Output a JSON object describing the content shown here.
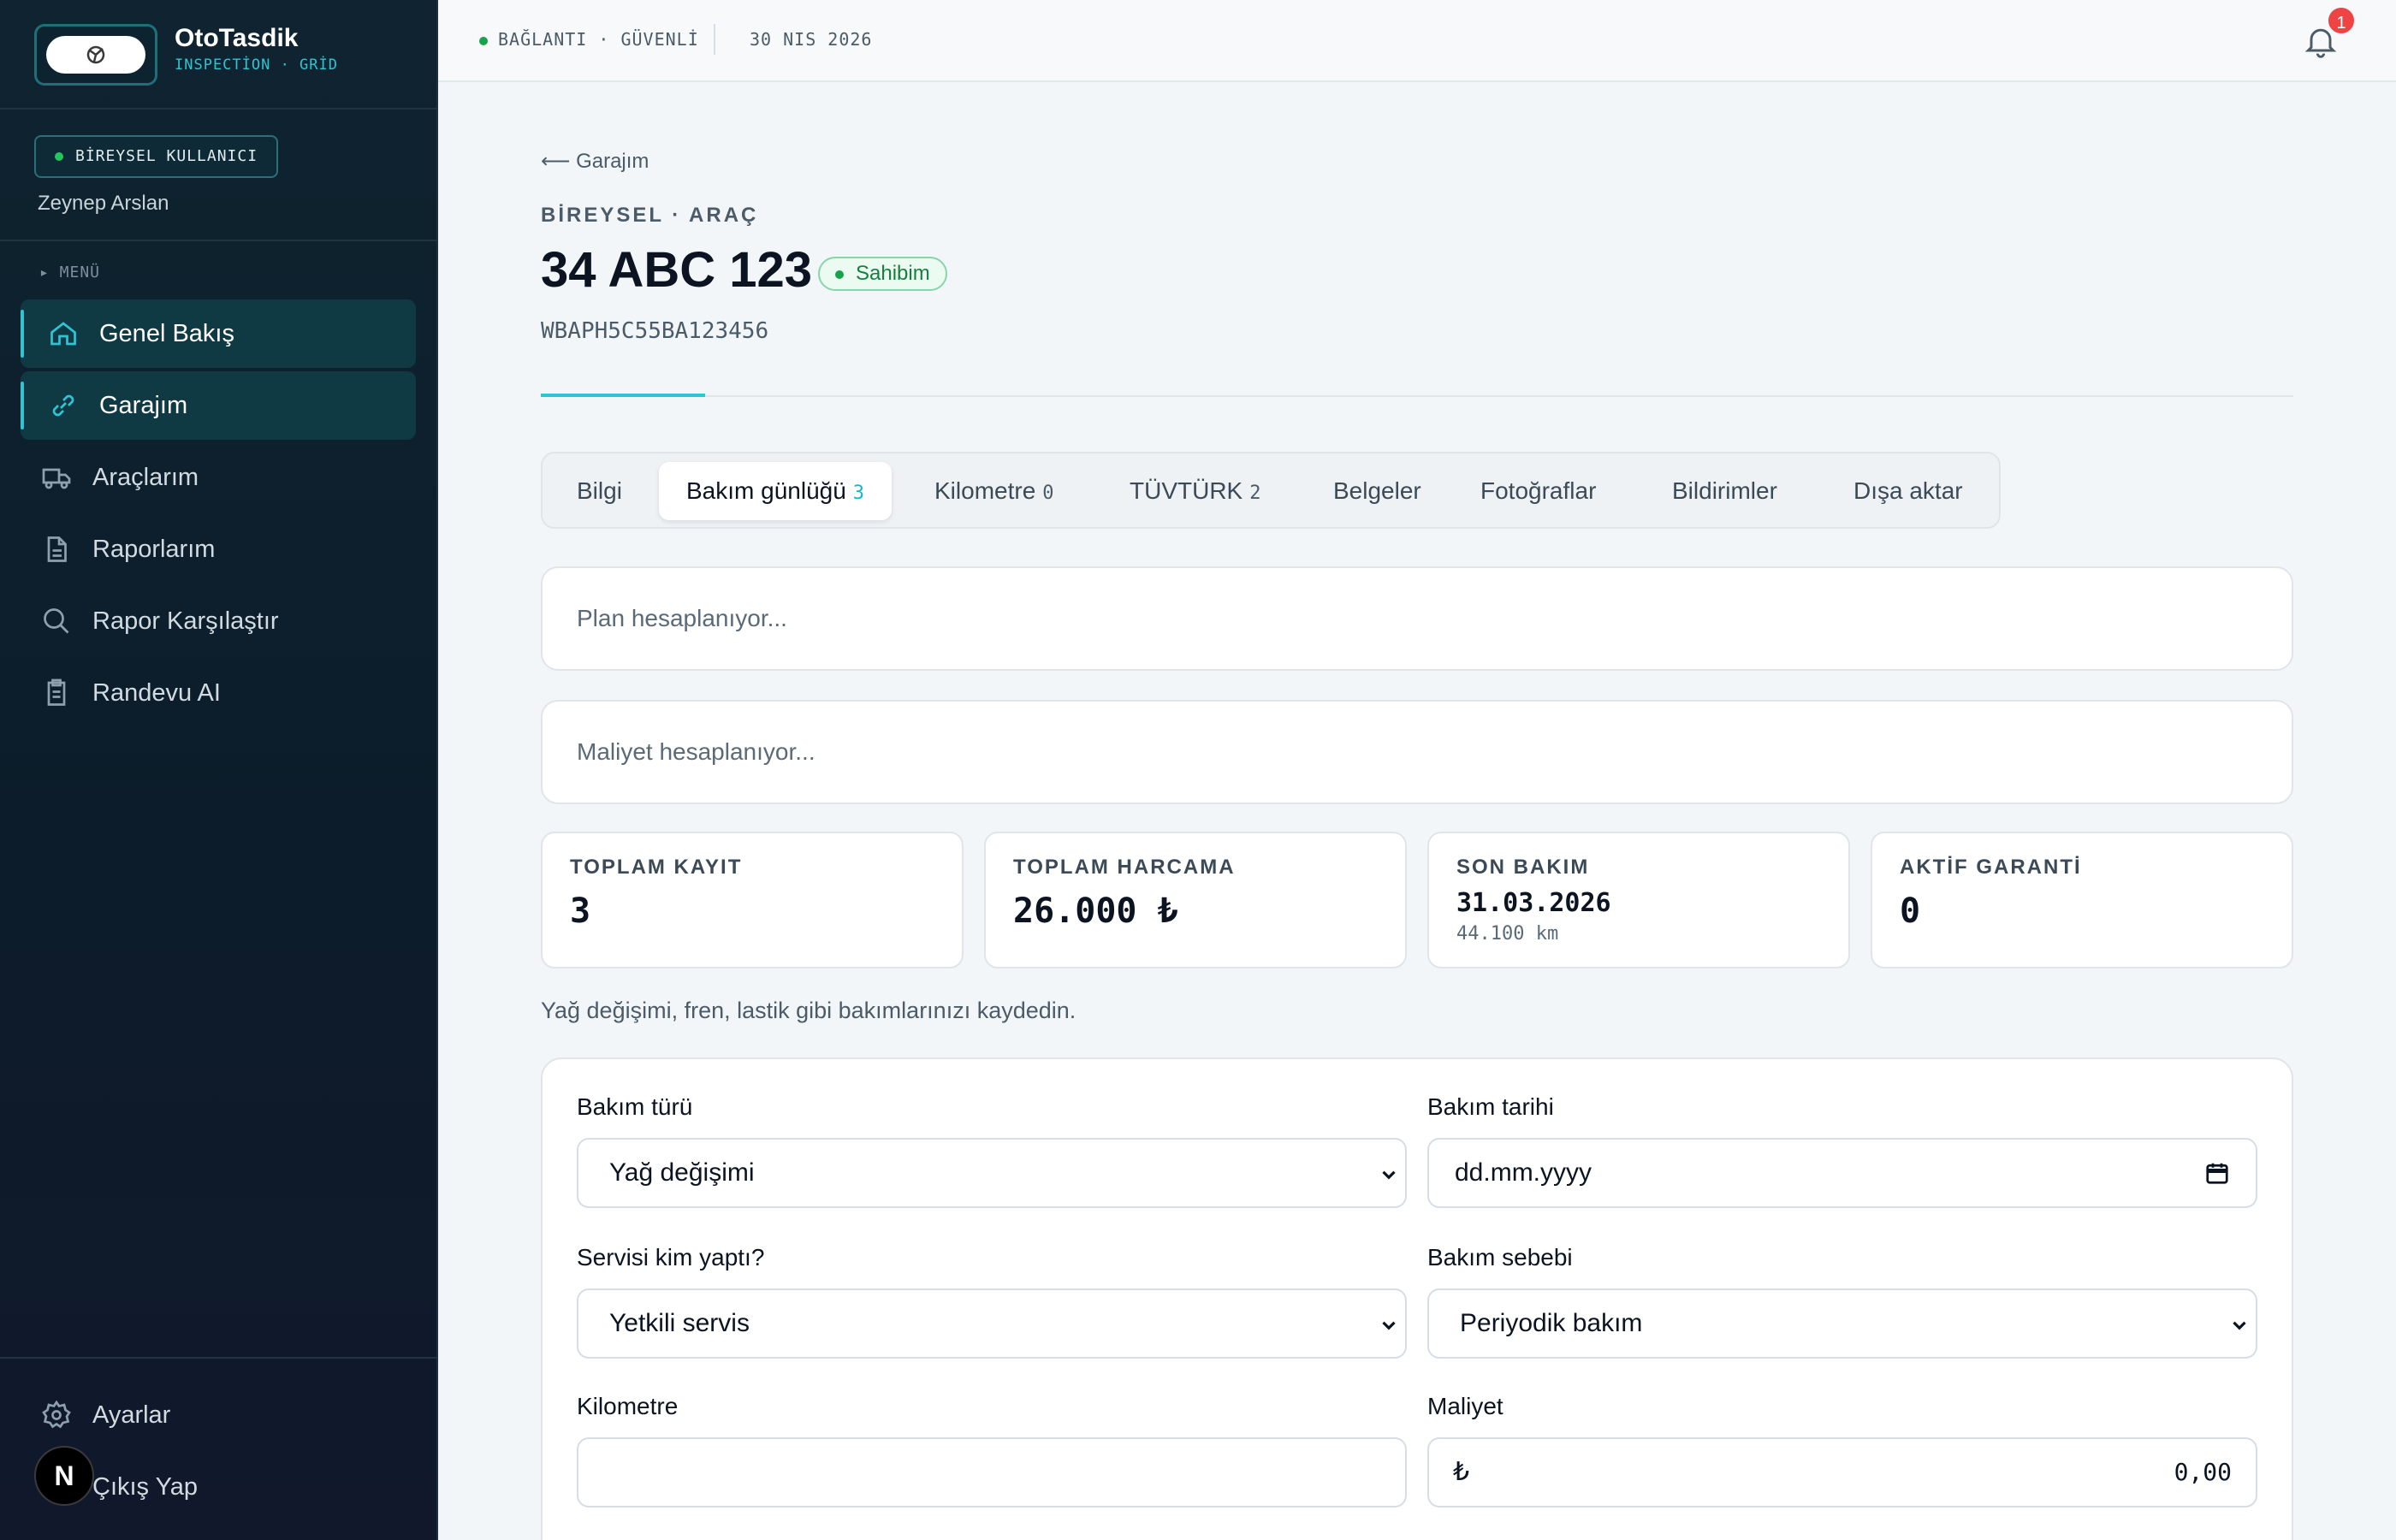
{
  "brand": {
    "name": "OtoTasdik",
    "tagline": "INSPECTİON · GRİD"
  },
  "user": {
    "role": "BİREYSEL KULLANICI",
    "name": "Zeynep Arslan"
  },
  "menu_label": "▸ MENÜ",
  "nav": [
    {
      "label": "Genel Bakış",
      "icon": "home-icon",
      "active": true
    },
    {
      "label": "Garajım",
      "icon": "link-icon",
      "active": true
    },
    {
      "label": "Araçlarım",
      "icon": "truck-icon",
      "active": false
    },
    {
      "label": "Raporlarım",
      "icon": "document-icon",
      "active": false
    },
    {
      "label": "Rapor Karşılaştır",
      "icon": "search-icon",
      "active": false
    },
    {
      "label": "Randevu AI",
      "icon": "clipboard-icon",
      "active": false
    }
  ],
  "bottom_nav": {
    "settings": "Ayarlar",
    "logout": "Çıkış Yap",
    "avatar_letter": "N"
  },
  "topbar": {
    "connection": "BAĞLANTI · GÜVENLİ",
    "date": "30 NIS 2026",
    "notification_count": "1"
  },
  "vehicle": {
    "back": "⟵ Garajım",
    "eyebrow": "BİREYSEL · ARAÇ",
    "plate": "34 ABC 123",
    "owner_badge": "Sahibim",
    "vin": "WBAPH5C55BA123456"
  },
  "tabs": [
    {
      "label": "Bilgi",
      "count": ""
    },
    {
      "label": "Bakım günlüğü",
      "count": "3",
      "active": true
    },
    {
      "label": "Kilometre",
      "count": "0"
    },
    {
      "label": "TÜVTÜRK",
      "count": "2"
    },
    {
      "label": "Belgeler",
      "count": ""
    },
    {
      "label": "Fotoğraflar",
      "count": ""
    },
    {
      "label": "Bildirimler",
      "count": ""
    },
    {
      "label": "Dışa aktar",
      "count": ""
    }
  ],
  "plan_text": "Plan hesaplanıyor...",
  "cost_text": "Maliyet hesaplanıyor...",
  "stats": [
    {
      "label": "TOPLAM KAYIT",
      "value": "3"
    },
    {
      "label": "TOPLAM HARCAMA",
      "value": "26.000 ₺"
    },
    {
      "label": "SON BAKIM",
      "value": "31.03.2026",
      "sub": "44.100 km"
    },
    {
      "label": "AKTİF GARANTİ",
      "value": "0"
    }
  ],
  "hint": "Yağ değişimi, fren, lastik gibi bakımlarınızı kaydedin.",
  "form": {
    "type_label": "Bakım türü",
    "type_value": "Yağ değişimi",
    "date_label": "Bakım tarihi",
    "date_placeholder": "dd.mm.yyyy",
    "service_label": "Servisi kim yaptı?",
    "service_value": "Yetkili servis",
    "reason_label": "Bakım sebebi",
    "reason_value": "Periyodik bakım",
    "km_label": "Kilometre",
    "km_value": "",
    "cost_label": "Maliyet",
    "cost_currency": "₺",
    "cost_value": "0,00"
  },
  "colors": {
    "accent": "#2ec4d4",
    "sidebar_bg": "#0c1c2a",
    "success": "#16a34a",
    "danger": "#ef4444"
  }
}
